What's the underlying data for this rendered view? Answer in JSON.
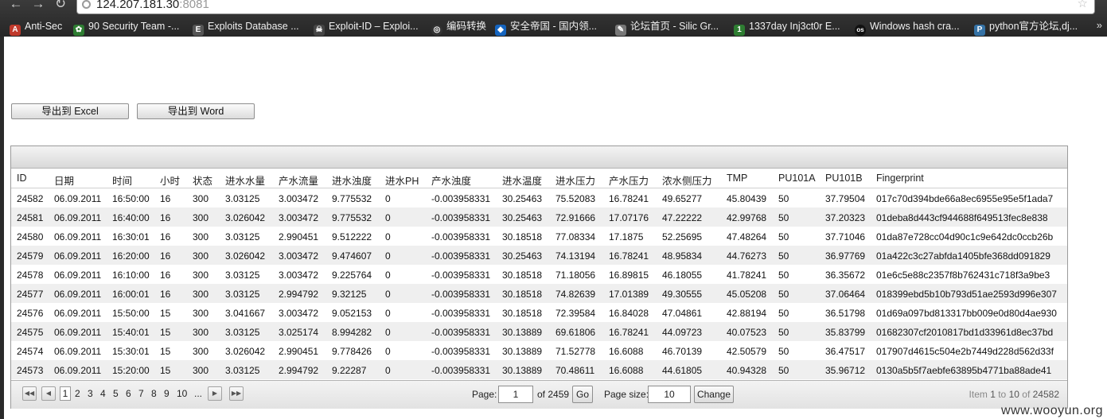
{
  "browser": {
    "url_host": "124.207.181.30",
    "url_port": ":8081",
    "bookmarks": [
      {
        "label": "Anti-Sec",
        "icon": "anti-sec-icon",
        "color": "#c0392b"
      },
      {
        "label": "90 Security Team -...",
        "icon": "leaf-icon",
        "color": "#2e7d32"
      },
      {
        "label": "Exploits Database ...",
        "icon": "exploit-db-icon",
        "color": "#555555"
      },
      {
        "label": "Exploit-ID – Exploi...",
        "icon": "skull-icon",
        "color": "#444444"
      },
      {
        "label": "编码转换",
        "icon": "globe-icon",
        "color": "#333333"
      },
      {
        "label": "安全帝国 - 国内领...",
        "icon": "shield-icon",
        "color": "#1565c0"
      },
      {
        "label": "论坛首页 - Silic Gr...",
        "icon": "forum-icon",
        "color": "#777777"
      },
      {
        "label": "1337day Inj3ct0r E...",
        "icon": "1337day-icon",
        "color": "#2e7d32"
      },
      {
        "label": "Windows hash cra...",
        "icon": "os-icon",
        "color": "#111111"
      },
      {
        "label": "python官方论坛,dj...",
        "icon": "python-icon",
        "color": "#3572a5"
      }
    ]
  },
  "actions": {
    "export_excel": "导出到 Excel",
    "export_word": "导出到 Word"
  },
  "table": {
    "columns": [
      "ID",
      "日期",
      "时间",
      "小时",
      "状态",
      "进水水量",
      "产水流量",
      "进水浊度",
      "进水PH",
      "产水浊度",
      "进水温度",
      "进水压力",
      "产水压力",
      "浓水侧压力",
      "TMP",
      "PU101A",
      "PU101B",
      "Fingerprint"
    ],
    "rows": [
      [
        "24582",
        "06.09.2011",
        "16:50:00",
        "16",
        "300",
        "3.03125",
        "3.003472",
        "9.775532",
        "0",
        "-0.003958331",
        "30.25463",
        "75.52083",
        "16.78241",
        "49.65277",
        "45.80439",
        "50",
        "37.79504",
        "017c70d394bde66a8ec6955e95e5f1ada7"
      ],
      [
        "24581",
        "06.09.2011",
        "16:40:00",
        "16",
        "300",
        "3.026042",
        "3.003472",
        "9.775532",
        "0",
        "-0.003958331",
        "30.25463",
        "72.91666",
        "17.07176",
        "47.22222",
        "42.99768",
        "50",
        "37.20323",
        "01deba8d443cf944688f649513fec8e838"
      ],
      [
        "24580",
        "06.09.2011",
        "16:30:01",
        "16",
        "300",
        "3.03125",
        "2.990451",
        "9.512222",
        "0",
        "-0.003958331",
        "30.18518",
        "77.08334",
        "17.1875",
        "52.25695",
        "47.48264",
        "50",
        "37.71046",
        "01da87e728cc04d90c1c9e642dc0ccb26b"
      ],
      [
        "24579",
        "06.09.2011",
        "16:20:00",
        "16",
        "300",
        "3.026042",
        "3.003472",
        "9.474607",
        "0",
        "-0.003958331",
        "30.25463",
        "74.13194",
        "16.78241",
        "48.95834",
        "44.76273",
        "50",
        "36.97769",
        "01a422c3c27abfda1405bfe368dd091829"
      ],
      [
        "24578",
        "06.09.2011",
        "16:10:00",
        "16",
        "300",
        "3.03125",
        "3.003472",
        "9.225764",
        "0",
        "-0.003958331",
        "30.18518",
        "71.18056",
        "16.89815",
        "46.18055",
        "41.78241",
        "50",
        "36.35672",
        "01e6c5e88c2357f8b762431c718f3a9be3"
      ],
      [
        "24577",
        "06.09.2011",
        "16:00:01",
        "16",
        "300",
        "3.03125",
        "2.994792",
        "9.32125",
        "0",
        "-0.003958331",
        "30.18518",
        "74.82639",
        "17.01389",
        "49.30555",
        "45.05208",
        "50",
        "37.06464",
        "018399ebd5b10b793d51ae2593d996e307"
      ],
      [
        "24576",
        "06.09.2011",
        "15:50:00",
        "15",
        "300",
        "3.041667",
        "3.003472",
        "9.052153",
        "0",
        "-0.003958331",
        "30.18518",
        "72.39584",
        "16.84028",
        "47.04861",
        "42.88194",
        "50",
        "36.51798",
        "01d69a097bd813317bb009e0d80d4ae930"
      ],
      [
        "24575",
        "06.09.2011",
        "15:40:01",
        "15",
        "300",
        "3.03125",
        "3.025174",
        "8.994282",
        "0",
        "-0.003958331",
        "30.13889",
        "69.61806",
        "16.78241",
        "44.09723",
        "40.07523",
        "50",
        "35.83799",
        "01682307cf2010817bd1d33961d8ec37bd"
      ],
      [
        "24574",
        "06.09.2011",
        "15:30:01",
        "15",
        "300",
        "3.026042",
        "2.990451",
        "9.778426",
        "0",
        "-0.003958331",
        "30.13889",
        "71.52778",
        "16.6088",
        "46.70139",
        "42.50579",
        "50",
        "36.47517",
        "017907d4615c504e2b7449d228d562d33f"
      ],
      [
        "24573",
        "06.09.2011",
        "15:20:00",
        "15",
        "300",
        "3.03125",
        "2.994792",
        "9.22287",
        "0",
        "-0.003958331",
        "30.13889",
        "70.48611",
        "16.6088",
        "44.61805",
        "40.94328",
        "50",
        "35.96712",
        "0130a5b5f7aebfe63895b4771ba88ade41"
      ]
    ]
  },
  "pager": {
    "pages": [
      "1",
      "2",
      "3",
      "4",
      "5",
      "6",
      "7",
      "8",
      "9",
      "10",
      "..."
    ],
    "current_page": "1",
    "page_label": "Page:",
    "page_value": "1",
    "of_total": "of 2459",
    "go_label": "Go",
    "page_size_label": "Page size:",
    "page_size_value": "10",
    "change_label": "Change",
    "items_prefix": "Item ",
    "items_from": "1",
    "items_to_word": " to ",
    "items_to": "10",
    "items_of": " of ",
    "items_total": "24582"
  },
  "watermark": "www.wooyun.org"
}
